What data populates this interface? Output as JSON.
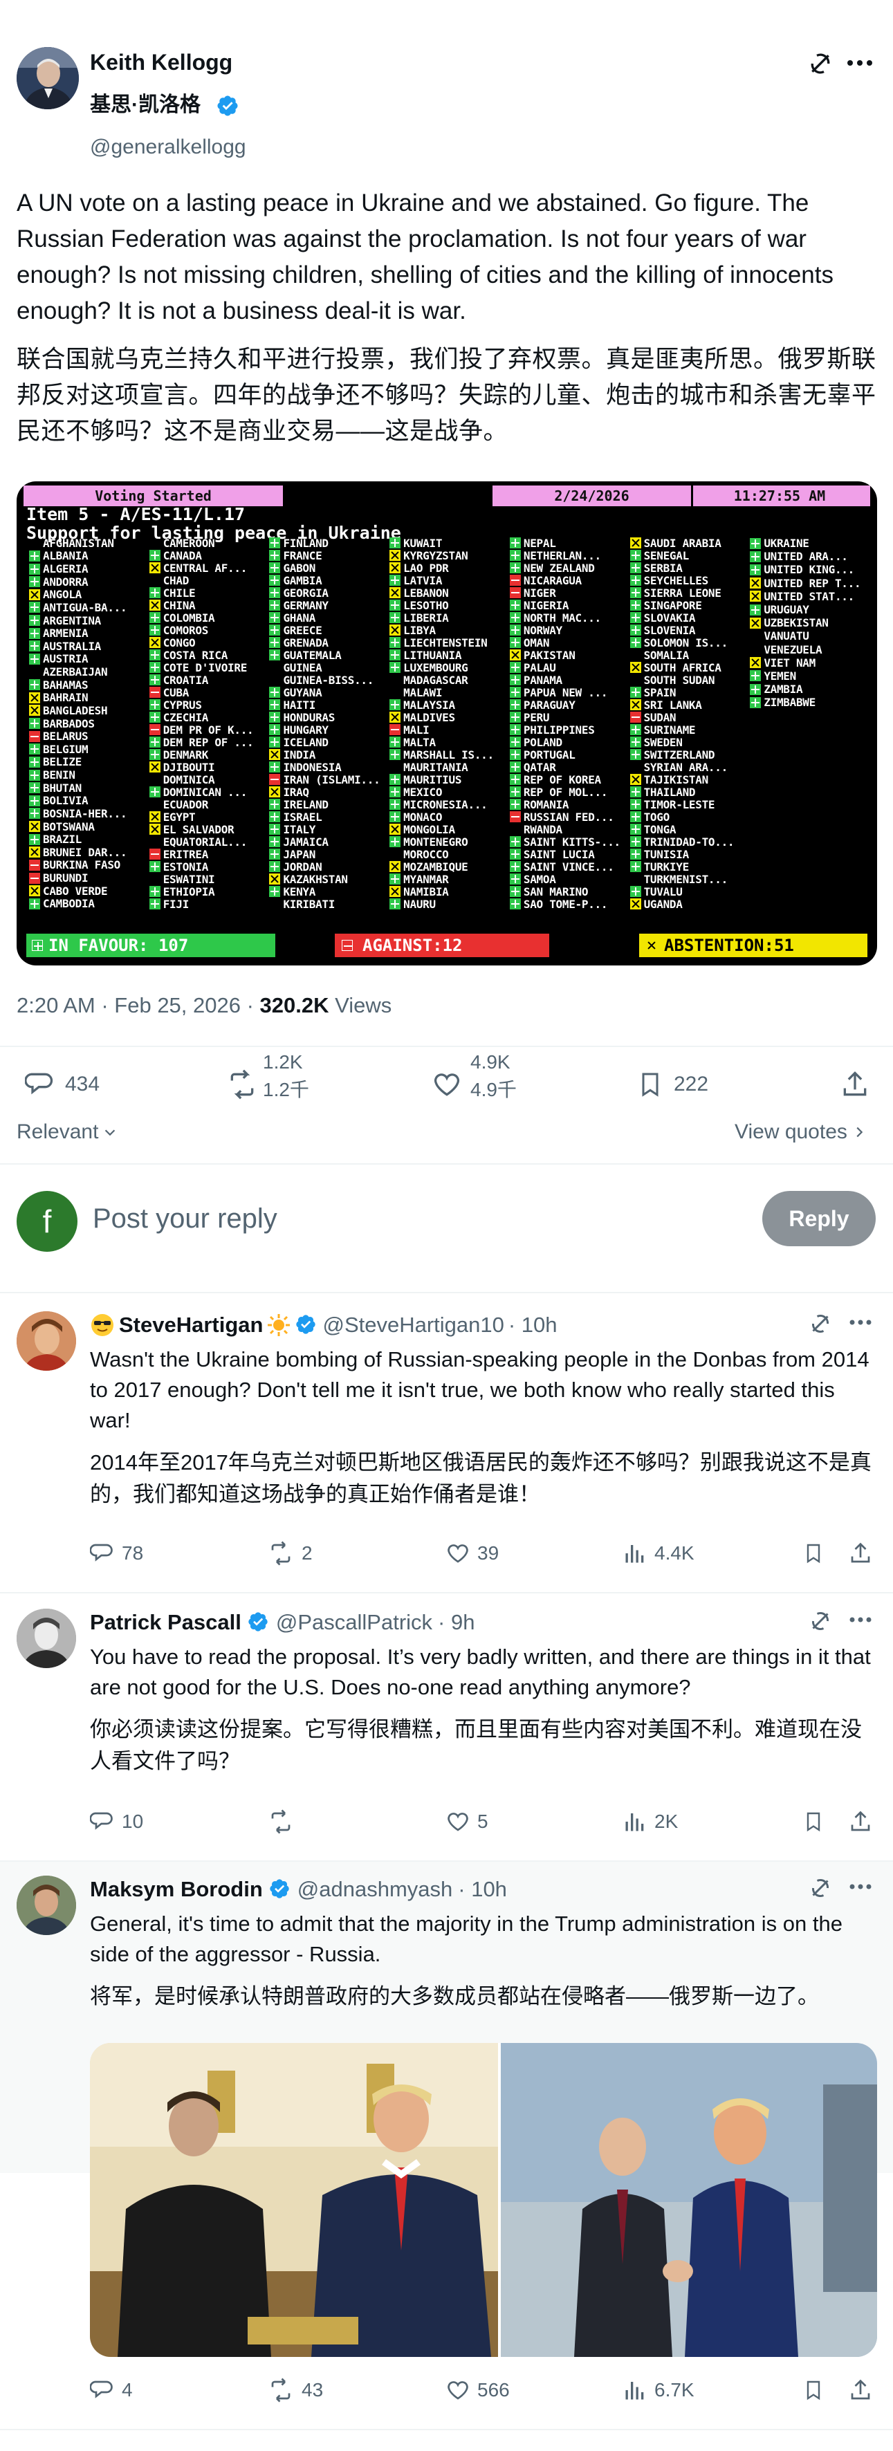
{
  "main_post": {
    "author_name": "Keith Kellogg",
    "author_cn": "基思·凯洛格",
    "handle": "@generalkellogg",
    "text_en": "A UN vote on a lasting peace in Ukraine and we abstained. Go figure. The Russian Federation was against the proclamation. Is not four years of war enough? Is not missing children, shelling of cities and the killing of innocents enough? It is not a business deal-it is war.",
    "text_cn": "联合国就乌克兰持久和平进行投票，我们投了弃权票。真是匪夷所思。俄罗斯联邦反对这项宣言。四年的战争还不够吗？失踪的儿童、炮击的城市和杀害无辜平民还不够吗？这不是商业交易——这是战争。",
    "timestamp": "2:20 AM · Feb 25, 2026 · ",
    "views_count": "320.2K",
    "views_label": " Views",
    "stats": {
      "replies": "434",
      "reposts": "1.2K",
      "reposts_cn": "1.2千",
      "likes": "4.9K",
      "likes_cn": "4.9千",
      "bookmarks": "222"
    }
  },
  "vote_board": {
    "status": "Voting Started",
    "date": "2/24/2026",
    "time": "11:27:55 AM",
    "item": "Item 5 - A/ES-11/L.17",
    "subtitle": "Support for lasting peace in Ukraine",
    "columns": [
      [
        [
          "X",
          "AFGHANISTAN"
        ],
        [
          "Y",
          "ALBANIA"
        ],
        [
          "Y",
          "ALGERIA"
        ],
        [
          "Y",
          "ANDORRA"
        ],
        [
          "A",
          "ANGOLA"
        ],
        [
          "Y",
          "ANTIGUA-BA..."
        ],
        [
          "Y",
          "ARGENTINA"
        ],
        [
          "Y",
          "ARMENIA"
        ],
        [
          "Y",
          "AUSTRALIA"
        ],
        [
          "Y",
          "AUSTRIA"
        ],
        [
          "X",
          "AZERBAIJAN"
        ],
        [
          "Y",
          "BAHAMAS"
        ],
        [
          "A",
          "BAHRAIN"
        ],
        [
          "A",
          "BANGLADESH"
        ],
        [
          "Y",
          "BARBADOS"
        ],
        [
          "N",
          "BELARUS"
        ],
        [
          "Y",
          "BELGIUM"
        ],
        [
          "Y",
          "BELIZE"
        ],
        [
          "Y",
          "BENIN"
        ],
        [
          "Y",
          "BHUTAN"
        ],
        [
          "Y",
          "BOLIVIA"
        ],
        [
          "Y",
          "BOSNIA-HER..."
        ],
        [
          "A",
          "BOTSWANA"
        ],
        [
          "Y",
          "BRAZIL"
        ],
        [
          "A",
          "BRUNEI DAR..."
        ],
        [
          "N",
          "BURKINA FASO"
        ],
        [
          "N",
          "BURUNDI"
        ],
        [
          "A",
          "CABO VERDE"
        ],
        [
          "Y",
          "CAMBODIA"
        ]
      ],
      [
        [
          "X",
          "CAMEROON"
        ],
        [
          "Y",
          "CANADA"
        ],
        [
          "A",
          "CENTRAL AF..."
        ],
        [
          "X",
          "CHAD"
        ],
        [
          "Y",
          "CHILE"
        ],
        [
          "A",
          "CHINA"
        ],
        [
          "Y",
          "COLOMBIA"
        ],
        [
          "Y",
          "COMOROS"
        ],
        [
          "A",
          "CONGO"
        ],
        [
          "Y",
          "COSTA RICA"
        ],
        [
          "Y",
          "COTE D'IVOIRE"
        ],
        [
          "Y",
          "CROATIA"
        ],
        [
          "N",
          "CUBA"
        ],
        [
          "Y",
          "CYPRUS"
        ],
        [
          "Y",
          "CZECHIA"
        ],
        [
          "N",
          "DEM PR OF K..."
        ],
        [
          "Y",
          "DEM REP OF ..."
        ],
        [
          "Y",
          "DENMARK"
        ],
        [
          "A",
          "DJIBOUTI"
        ],
        [
          "X",
          "DOMINICA"
        ],
        [
          "Y",
          "DOMINICAN ..."
        ],
        [
          "X",
          "ECUADOR"
        ],
        [
          "A",
          "EGYPT"
        ],
        [
          "A",
          "EL SALVADOR"
        ],
        [
          "X",
          "EQUATORIAL..."
        ],
        [
          "N",
          "ERITREA"
        ],
        [
          "Y",
          "ESTONIA"
        ],
        [
          "X",
          "ESWATINI"
        ],
        [
          "Y",
          "ETHIOPIA"
        ],
        [
          "Y",
          "FIJI"
        ]
      ],
      [
        [
          "Y",
          "FINLAND"
        ],
        [
          "Y",
          "FRANCE"
        ],
        [
          "Y",
          "GABON"
        ],
        [
          "Y",
          "GAMBIA"
        ],
        [
          "Y",
          "GEORGIA"
        ],
        [
          "Y",
          "GERMANY"
        ],
        [
          "Y",
          "GHANA"
        ],
        [
          "Y",
          "GREECE"
        ],
        [
          "Y",
          "GRENADA"
        ],
        [
          "Y",
          "GUATEMALA"
        ],
        [
          "X",
          "GUINEA"
        ],
        [
          "X",
          "GUINEA-BISS..."
        ],
        [
          "Y",
          "GUYANA"
        ],
        [
          "Y",
          "HAITI"
        ],
        [
          "Y",
          "HONDURAS"
        ],
        [
          "Y",
          "HUNGARY"
        ],
        [
          "Y",
          "ICELAND"
        ],
        [
          "A",
          "INDIA"
        ],
        [
          "Y",
          "INDONESIA"
        ],
        [
          "N",
          "IRAN (ISLAMI..."
        ],
        [
          "A",
          "IRAQ"
        ],
        [
          "Y",
          "IRELAND"
        ],
        [
          "Y",
          "ISRAEL"
        ],
        [
          "Y",
          "ITALY"
        ],
        [
          "Y",
          "JAMAICA"
        ],
        [
          "Y",
          "JAPAN"
        ],
        [
          "Y",
          "JORDAN"
        ],
        [
          "A",
          "KAZAKHSTAN"
        ],
        [
          "Y",
          "KENYA"
        ],
        [
          "X",
          "KIRIBATI"
        ]
      ],
      [
        [
          "Y",
          "KUWAIT"
        ],
        [
          "A",
          "KYRGYZSTAN"
        ],
        [
          "A",
          "LAO PDR"
        ],
        [
          "Y",
          "LATVIA"
        ],
        [
          "A",
          "LEBANON"
        ],
        [
          "Y",
          "LESOTHO"
        ],
        [
          "Y",
          "LIBERIA"
        ],
        [
          "A",
          "LIBYA"
        ],
        [
          "Y",
          "LIECHTENSTEIN"
        ],
        [
          "Y",
          "LITHUANIA"
        ],
        [
          "Y",
          "LUXEMBOURG"
        ],
        [
          "X",
          "MADAGASCAR"
        ],
        [
          "X",
          "MALAWI"
        ],
        [
          "Y",
          "MALAYSIA"
        ],
        [
          "A",
          "MALDIVES"
        ],
        [
          "N",
          "MALI"
        ],
        [
          "Y",
          "MALTA"
        ],
        [
          "Y",
          "MARSHALL IS..."
        ],
        [
          "X",
          "MAURITANIA"
        ],
        [
          "Y",
          "MAURITIUS"
        ],
        [
          "Y",
          "MEXICO"
        ],
        [
          "Y",
          "MICRONESIA..."
        ],
        [
          "Y",
          "MONACO"
        ],
        [
          "A",
          "MONGOLIA"
        ],
        [
          "Y",
          "MONTENEGRO"
        ],
        [
          "X",
          "MOROCCO"
        ],
        [
          "A",
          "MOZAMBIQUE"
        ],
        [
          "Y",
          "MYANMAR"
        ],
        [
          "A",
          "NAMIBIA"
        ],
        [
          "Y",
          "NAURU"
        ]
      ],
      [
        [
          "Y",
          "NEPAL"
        ],
        [
          "Y",
          "NETHERLAN..."
        ],
        [
          "Y",
          "NEW ZEALAND"
        ],
        [
          "N",
          "NICARAGUA"
        ],
        [
          "N",
          "NIGER"
        ],
        [
          "Y",
          "NIGERIA"
        ],
        [
          "Y",
          "NORTH MAC..."
        ],
        [
          "Y",
          "NORWAY"
        ],
        [
          "Y",
          "OMAN"
        ],
        [
          "A",
          "PAKISTAN"
        ],
        [
          "Y",
          "PALAU"
        ],
        [
          "Y",
          "PANAMA"
        ],
        [
          "Y",
          "PAPUA NEW ..."
        ],
        [
          "Y",
          "PARAGUAY"
        ],
        [
          "Y",
          "PERU"
        ],
        [
          "Y",
          "PHILIPPINES"
        ],
        [
          "Y",
          "POLAND"
        ],
        [
          "Y",
          "PORTUGAL"
        ],
        [
          "Y",
          "QATAR"
        ],
        [
          "Y",
          "REP OF KOREA"
        ],
        [
          "Y",
          "REP OF MOL..."
        ],
        [
          "Y",
          "ROMANIA"
        ],
        [
          "N",
          "RUSSIAN FED..."
        ],
        [
          "X",
          "RWANDA"
        ],
        [
          "Y",
          "SAINT KITTS-..."
        ],
        [
          "Y",
          "SAINT LUCIA"
        ],
        [
          "Y",
          "SAINT VINCE..."
        ],
        [
          "Y",
          "SAMOA"
        ],
        [
          "Y",
          "SAN MARINO"
        ],
        [
          "Y",
          "SAO TOME-P..."
        ]
      ],
      [
        [
          "A",
          "SAUDI ARABIA"
        ],
        [
          "Y",
          "SENEGAL"
        ],
        [
          "Y",
          "SERBIA"
        ],
        [
          "Y",
          "SEYCHELLES"
        ],
        [
          "Y",
          "SIERRA LEONE"
        ],
        [
          "Y",
          "SINGAPORE"
        ],
        [
          "Y",
          "SLOVAKIA"
        ],
        [
          "Y",
          "SLOVENIA"
        ],
        [
          "Y",
          "SOLOMON IS..."
        ],
        [
          "X",
          "SOMALIA"
        ],
        [
          "A",
          "SOUTH AFRICA"
        ],
        [
          "X",
          "SOUTH SUDAN"
        ],
        [
          "Y",
          "SPAIN"
        ],
        [
          "A",
          "SRI LANKA"
        ],
        [
          "N",
          "SUDAN"
        ],
        [
          "Y",
          "SURINAME"
        ],
        [
          "Y",
          "SWEDEN"
        ],
        [
          "Y",
          "SWITZERLAND"
        ],
        [
          "X",
          "SYRIAN ARA..."
        ],
        [
          "A",
          "TAJIKISTAN"
        ],
        [
          "Y",
          "THAILAND"
        ],
        [
          "Y",
          "TIMOR-LESTE"
        ],
        [
          "Y",
          "TOGO"
        ],
        [
          "Y",
          "TONGA"
        ],
        [
          "Y",
          "TRINIDAD-TO..."
        ],
        [
          "Y",
          "TUNISIA"
        ],
        [
          "Y",
          "TURKIYE"
        ],
        [
          "X",
          "TURKMENIST..."
        ],
        [
          "Y",
          "TUVALU"
        ],
        [
          "A",
          "UGANDA"
        ]
      ],
      [
        [
          "Y",
          "UKRAINE"
        ],
        [
          "Y",
          "UNITED ARA..."
        ],
        [
          "Y",
          "UNITED KING..."
        ],
        [
          "A",
          "UNITED REP T..."
        ],
        [
          "A",
          "UNITED STAT..."
        ],
        [
          "Y",
          "URUGUAY"
        ],
        [
          "A",
          "UZBEKISTAN"
        ],
        [
          "X",
          "VANUATU"
        ],
        [
          "X",
          "VENEZUELA"
        ],
        [
          "A",
          "VIET NAM"
        ],
        [
          "Y",
          "YEMEN"
        ],
        [
          "Y",
          "ZAMBIA"
        ],
        [
          "Y",
          "ZIMBABWE"
        ]
      ]
    ],
    "in_favour": "IN FAVOUR: 107",
    "against": "AGAINST:12",
    "abstention": "ABSTENTION:51"
  },
  "sort": {
    "label": "Relevant",
    "view_quotes": "View quotes"
  },
  "compose": {
    "avatar_letter": "f",
    "placeholder": "Post your reply",
    "button": "Reply"
  },
  "replies": [
    {
      "name": "SteveHartigan",
      "handle": "@SteveHartigan10",
      "time": " · 10h",
      "text_en": "Wasn't the Ukraine bombing of Russian-speaking people in the Donbas from 2014 to 2017 enough? Don't tell me it isn't true, we both know who really started this war!",
      "text_cn": "2014年至2017年乌克兰对顿巴斯地区俄语居民的轰炸还不够吗？别跟我说这不是真的，我们都知道这场战争的真正始作俑者是谁！",
      "stats": {
        "replies": "78",
        "reposts": "2",
        "likes": "39",
        "views": "4.4K"
      }
    },
    {
      "name": "Patrick Pascall",
      "handle": "@PascallPatrick",
      "time": " · 9h",
      "text_en": "You have to read the proposal. It’s very badly written, and there are things in it that are not good for the U.S.  Does no-one read anything anymore?",
      "text_cn": "你必须读读这份提案。它写得很糟糕，而且里面有些内容对美国不利。难道现在没人看文件了吗？",
      "stats": {
        "replies": "10",
        "reposts": "",
        "likes": "5",
        "views": "2K"
      }
    },
    {
      "name": "Maksym Borodin",
      "handle": "@adnashmyash",
      "time": " · 10h",
      "text_en": "General, it's time to admit that the majority in the Trump administration is on the side of the aggressor - Russia.",
      "text_cn": "将军，是时候承认特朗普政府的大多数成员都站在侵略者——俄罗斯一边了。",
      "stats": {
        "replies": "4",
        "reposts": "43",
        "likes": "566",
        "views": "6.7K"
      }
    }
  ],
  "colors": {
    "accent": "#1d9bf0",
    "text": "#0f1419",
    "muted": "#536471",
    "divider": "#eff3f4"
  }
}
